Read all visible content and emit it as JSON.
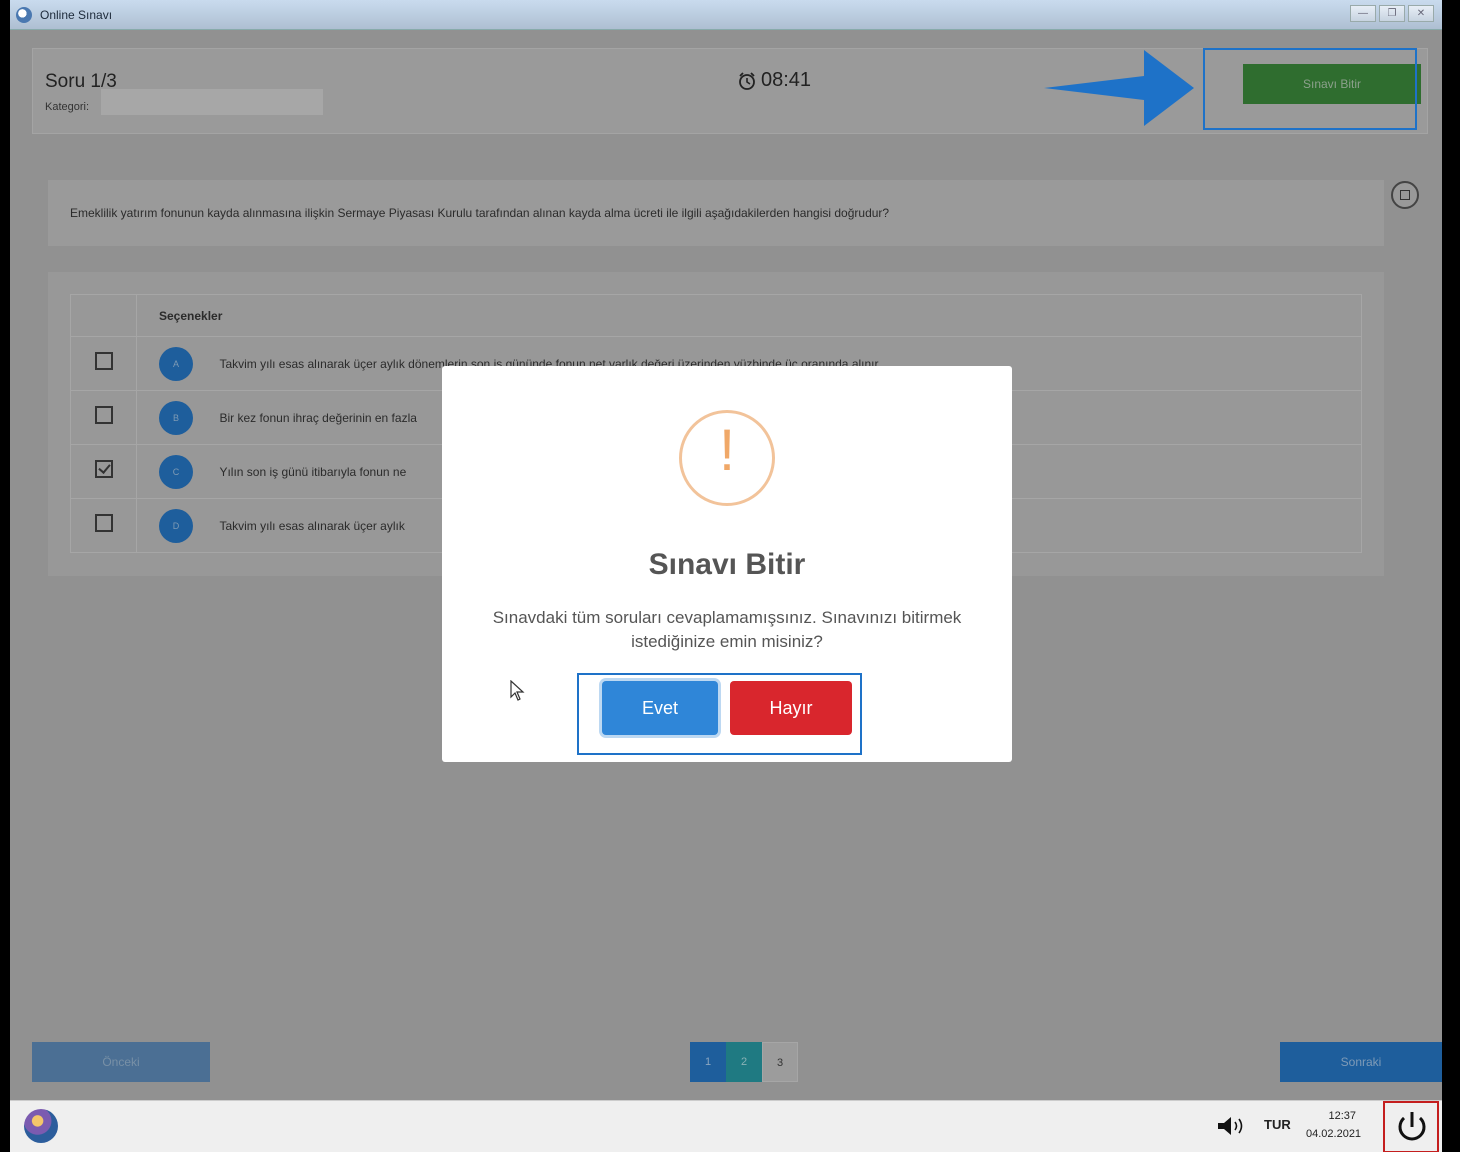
{
  "window": {
    "title": "Online Sınavı",
    "buttons": [
      "—",
      "❐",
      "✕"
    ]
  },
  "header": {
    "question_counter": "Soru 1/3",
    "category_label": "Kategori:",
    "timer": "08:41",
    "finish_button": "Sınavı Bitir"
  },
  "question": {
    "text": "Emeklilik yatırım fonunun kayda alınmasına ilişkin Sermaye Piyasası Kurulu tarafından alınan kayda alma ücreti ile ilgili aşağıdakilerden hangisi doğrudur?"
  },
  "options": {
    "header": "Seçenekler",
    "items": [
      {
        "letter": "A",
        "text": "Takvim yılı esas alınarak üçer aylık dönemlerin son iş gününde fonun net varlık değeri üzerinden yüzbinde üç oranında alınır.",
        "checked": false
      },
      {
        "letter": "B",
        "text": "Bir kez fonun ihraç değerinin en fazla",
        "checked": false
      },
      {
        "letter": "C",
        "text": "Yılın son iş günü itibarıyla fonun ne",
        "checked": true
      },
      {
        "letter": "D",
        "text": "Takvim yılı esas alınarak üçer aylık",
        "checked": false
      }
    ]
  },
  "navigation": {
    "previous": "Önceki",
    "next": "Sonraki",
    "pages": [
      "1",
      "2",
      "3"
    ]
  },
  "modal": {
    "icon": "!",
    "title": "Sınavı Bitir",
    "message": "Sınavdaki tüm soruları cevaplamamışsınız. Sınavınızı bitirmek istediğinize emin misiniz?",
    "yes": "Evet",
    "no": "Hayır"
  },
  "taskbar": {
    "language": "TUR",
    "time": "12:37",
    "date": "04.02.2021"
  },
  "colors": {
    "finish_green": "#2f6d2f",
    "yes_blue": "#2f86d8",
    "no_red": "#d9262d",
    "annotation_blue": "#1e72c8",
    "annotation_red": "#c41e1e"
  }
}
